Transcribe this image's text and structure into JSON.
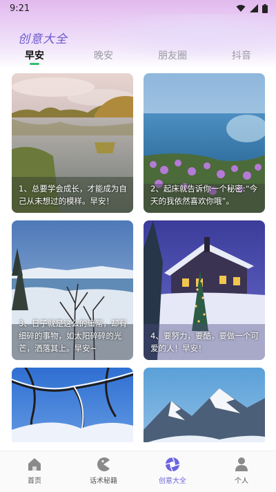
{
  "status_bar": {
    "time": "9:21"
  },
  "app": {
    "title": "创意大全"
  },
  "tabs": [
    {
      "label": "早安",
      "active": true
    },
    {
      "label": "晚安",
      "active": false
    },
    {
      "label": "朋友圈",
      "active": false
    },
    {
      "label": "抖音",
      "active": false
    }
  ],
  "cards": [
    {
      "caption": "1、总要学会成长，才能成为自己从未想过的模样。早安！",
      "image": "autumn lake with trees"
    },
    {
      "caption": "2、起床就告诉你一个秘密:“今天的我依然喜欢你哦”。",
      "image": "seaside with purple flowers"
    },
    {
      "caption": "3、日子就是这么的庸常，却有细碎的事物，如太阳碎碎的光芒，洒落其上。早安~",
      "image": "snowy lake with bare trees"
    },
    {
      "caption": "4、要努力，要酷，要做一个可爱的人！早安！",
      "image": "snowy house with christmas tree"
    },
    {
      "caption": "",
      "image": "snowy branches against blue sky"
    },
    {
      "caption": "",
      "image": "snowy mountains"
    }
  ],
  "bottom_nav": [
    {
      "label": "首页",
      "icon": "home-icon",
      "active": false
    },
    {
      "label": "话术秘籍",
      "icon": "pacman-icon",
      "active": false
    },
    {
      "label": "创意大全",
      "icon": "aperture-icon",
      "active": true
    },
    {
      "label": "个人",
      "icon": "person-icon",
      "active": false
    }
  ],
  "colors": {
    "accent": "#6c63e0",
    "tab_indicator": "#2fbf6c",
    "title": "#6a5acd"
  }
}
